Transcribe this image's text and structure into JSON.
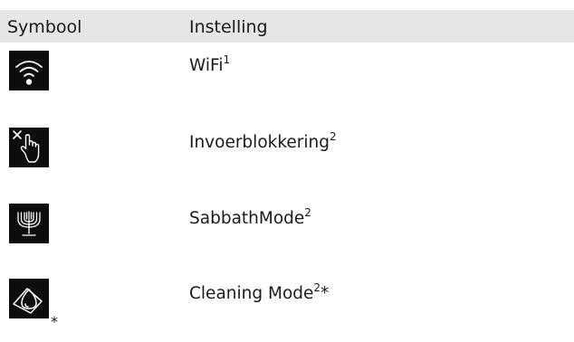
{
  "header": {
    "symbol_label": "Symbool",
    "setting_label": "Instelling"
  },
  "rows": [
    {
      "icon": "wifi-icon",
      "label": "WiFi",
      "sup": "1",
      "suffix": ""
    },
    {
      "icon": "input-lock-icon",
      "label": "Invoerblokkering",
      "sup": "2",
      "suffix": ""
    },
    {
      "icon": "sabbath-menorah-icon",
      "label": "SabbathMode",
      "sup": "2",
      "suffix": ""
    },
    {
      "icon": "cleaning-icon",
      "label": "Cleaning Mode",
      "sup": "2",
      "suffix": "*",
      "icon_note": "*"
    }
  ]
}
